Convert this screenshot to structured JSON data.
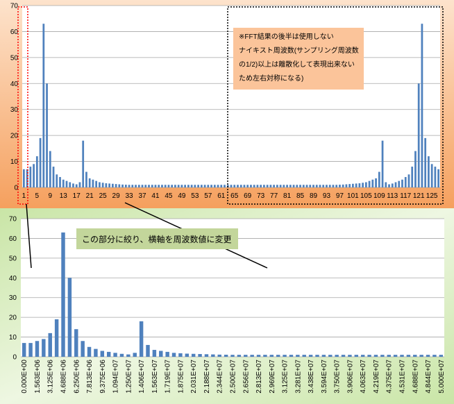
{
  "chart_data": [
    {
      "type": "bar",
      "xlabel": "",
      "ylabel": "",
      "ylim": [
        0,
        70
      ],
      "y_ticks": [
        0,
        10,
        20,
        30,
        40,
        50,
        60,
        70
      ],
      "grid": true,
      "x": [
        1,
        2,
        3,
        4,
        5,
        6,
        7,
        8,
        9,
        10,
        11,
        12,
        13,
        14,
        15,
        16,
        17,
        18,
        19,
        20,
        21,
        22,
        23,
        24,
        25,
        26,
        27,
        28,
        29,
        30,
        31,
        32,
        33,
        34,
        35,
        36,
        37,
        38,
        39,
        40,
        41,
        42,
        43,
        44,
        45,
        46,
        47,
        48,
        49,
        50,
        51,
        52,
        53,
        54,
        55,
        56,
        57,
        58,
        59,
        60,
        61,
        62,
        63,
        64,
        65,
        66,
        67,
        68,
        69,
        70,
        71,
        72,
        73,
        74,
        75,
        76,
        77,
        78,
        79,
        80,
        81,
        82,
        83,
        84,
        85,
        86,
        87,
        88,
        89,
        90,
        91,
        92,
        93,
        94,
        95,
        96,
        97,
        98,
        99,
        100,
        101,
        102,
        103,
        104,
        105,
        106,
        107,
        108,
        109,
        110,
        111,
        112,
        113,
        114,
        115,
        116,
        117,
        118,
        119,
        120,
        121,
        122,
        123,
        124,
        125,
        126,
        127,
        128
      ],
      "x_tick_labels": [
        "1",
        "5",
        "9",
        "13",
        "17",
        "21",
        "25",
        "29",
        "33",
        "37",
        "41",
        "45",
        "49",
        "53",
        "57",
        "61",
        "65",
        "69",
        "73",
        "77",
        "81",
        "85",
        "89",
        "93",
        "97",
        "101",
        "105",
        "109",
        "113",
        "117",
        "121",
        "125"
      ],
      "values": [
        7,
        7,
        8,
        9,
        12,
        19,
        63,
        40,
        14,
        8,
        5,
        4,
        3,
        2.5,
        2,
        1.5,
        1.2,
        2,
        18,
        6,
        3.5,
        3,
        2.5,
        2,
        1.8,
        1.6,
        1.5,
        1.4,
        1.3,
        1.2,
        1.1,
        1.05,
        1,
        1,
        1,
        1,
        1,
        1,
        1,
        1,
        1,
        1,
        1,
        1,
        1,
        1,
        1,
        1,
        1,
        1,
        1,
        1,
        1,
        1,
        1,
        1,
        1,
        1,
        1,
        1,
        1,
        1,
        1,
        1,
        1,
        1,
        1,
        1,
        1,
        1,
        1,
        1,
        1,
        1,
        1,
        1,
        1,
        1,
        1,
        1,
        1,
        1,
        1,
        1,
        1,
        1,
        1,
        1,
        1,
        1,
        1,
        1,
        1,
        1,
        1,
        1,
        1.05,
        1.1,
        1.2,
        1.3,
        1.4,
        1.5,
        1.6,
        1.8,
        2,
        2.5,
        3,
        3.5,
        6,
        18,
        2,
        1.2,
        1.5,
        2,
        2.5,
        3,
        4,
        5,
        8,
        14,
        40,
        63,
        19,
        12,
        9,
        8,
        7
      ]
    },
    {
      "type": "bar",
      "xlabel": "",
      "ylabel": "",
      "ylim": [
        0,
        70
      ],
      "y_ticks": [
        0,
        10,
        20,
        30,
        40,
        50,
        60,
        70
      ],
      "grid": true,
      "x_tick_labels": [
        "0.000E+00",
        "1.563E+06",
        "3.125E+06",
        "4.688E+06",
        "6.250E+06",
        "7.813E+06",
        "9.375E+06",
        "1.094E+07",
        "1.250E+07",
        "1.406E+07",
        "1.563E+07",
        "1.719E+07",
        "1.875E+07",
        "2.031E+07",
        "2.188E+07",
        "2.344E+07",
        "2.500E+07",
        "2.656E+07",
        "2.813E+07",
        "2.969E+07",
        "3.125E+07",
        "3.281E+07",
        "3.438E+07",
        "3.594E+07",
        "3.750E+07",
        "3.906E+07",
        "4.063E+07",
        "4.219E+07",
        "4.375E+07",
        "4.531E+07",
        "4.688E+07",
        "4.844E+07",
        "5.000E+07"
      ],
      "values": [
        7,
        7,
        8,
        9,
        12,
        19,
        63,
        40,
        14,
        8,
        5,
        4,
        3,
        2.5,
        2,
        1.5,
        1.2,
        2,
        18,
        6,
        3.5,
        3,
        2.5,
        2,
        1.8,
        1.6,
        1.5,
        1.4,
        1.3,
        1.2,
        1.1,
        1.05,
        1,
        1,
        1,
        1,
        1,
        1,
        1,
        1,
        1,
        1,
        1,
        1,
        1,
        1,
        1,
        1,
        1,
        1,
        1,
        1,
        1,
        1,
        1,
        1,
        1,
        1,
        1,
        1,
        1,
        1,
        1,
        1,
        1
      ]
    }
  ],
  "annotations": {
    "note_lines": [
      "※FFT結果の後半は使用しない",
      "ナイキスト周波数(サンプリング周波数",
      "の1/2)以上は離散化して表現出来ない",
      "ため左右対称になる)"
    ],
    "callout": "この部分に絞り、横軸を周波数値に変更"
  },
  "colors": {
    "bar": "#4f81bd",
    "top_bg_dark": "#f5a05e",
    "top_bg_light": "#fde3cc",
    "bottom_bg_dark": "#c9e5a6",
    "bottom_bg_light": "#eef7e2",
    "note_bg": "#fbc49a",
    "callout_bg": "#c3d69b",
    "highlight_red": "#ff0000"
  }
}
